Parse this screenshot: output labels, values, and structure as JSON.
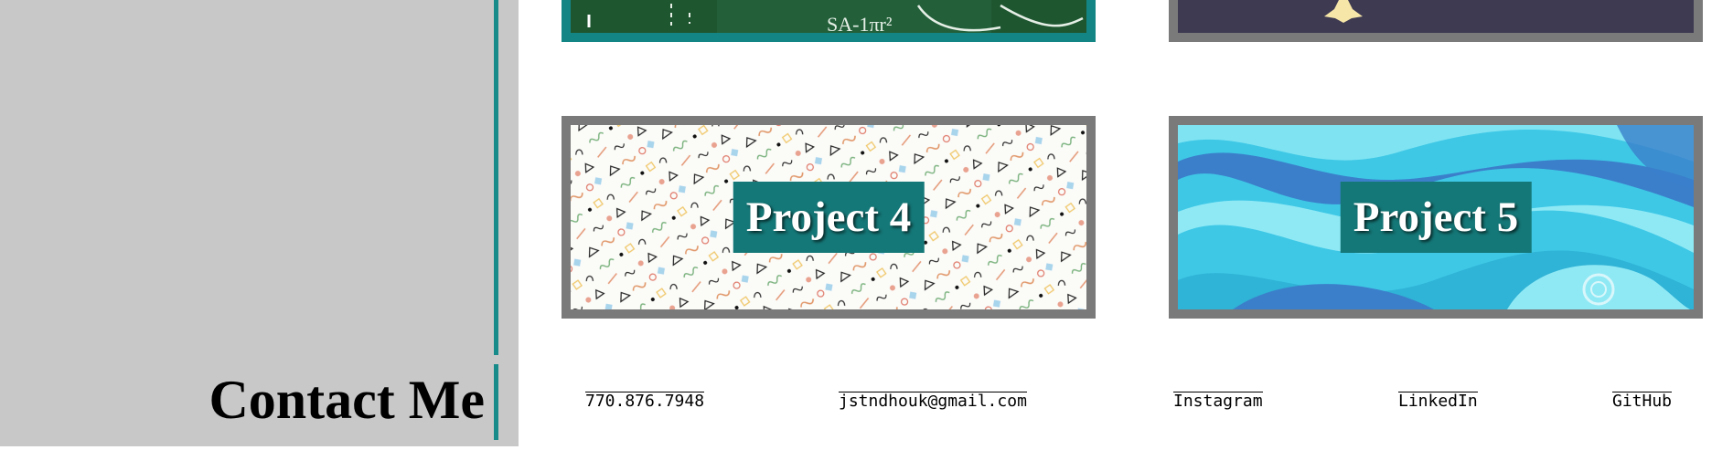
{
  "sidebar": {
    "contact_heading": "Contact Me"
  },
  "projects": [
    {
      "label": "",
      "pattern": "chalkboard"
    },
    {
      "label": "",
      "pattern": "night-star"
    },
    {
      "label": "Project 4",
      "pattern": "memphis-confetti"
    },
    {
      "label": "Project 5",
      "pattern": "blue-waves"
    }
  ],
  "contact_links": [
    {
      "label": "770.876.7948",
      "icon": "phone-link"
    },
    {
      "label": "jstndhouk@gmail.com",
      "icon": "email-link"
    },
    {
      "label": "Instagram",
      "icon": "instagram-link"
    },
    {
      "label": "LinkedIn",
      "icon": "linkedin-link"
    },
    {
      "label": "GitHub",
      "icon": "github-link"
    }
  ],
  "colors": {
    "accent_teal": "#178a8a",
    "label_teal": "#157878",
    "sidebar_gray": "#c8c8c8",
    "card_border_gray": "#7a7a7a"
  }
}
